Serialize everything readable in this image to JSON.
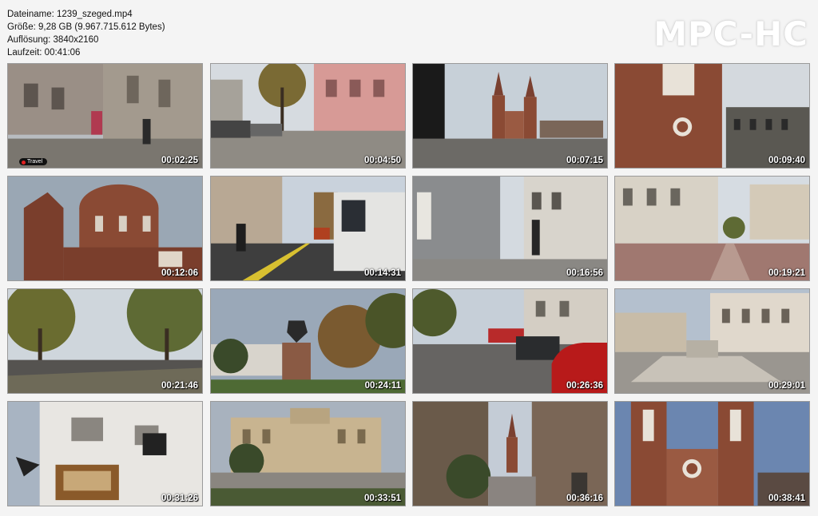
{
  "file_info": {
    "filename": "Dateiname: 1239_szeged.mp4",
    "size": "Größe: 9,28 GB (9.967.715.612 Bytes)",
    "resolution": "Auflösung: 3840x2160",
    "duration": "Laufzeit: 00:41:06"
  },
  "brand": "MPC-HC",
  "thumbnails": [
    {
      "timestamp": "00:02:25",
      "badge": "Travel"
    },
    {
      "timestamp": "00:04:50"
    },
    {
      "timestamp": "00:07:15"
    },
    {
      "timestamp": "00:09:40"
    },
    {
      "timestamp": "00:12:06"
    },
    {
      "timestamp": "00:14:31"
    },
    {
      "timestamp": "00:16:56"
    },
    {
      "timestamp": "00:19:21"
    },
    {
      "timestamp": "00:21:46"
    },
    {
      "timestamp": "00:24:11"
    },
    {
      "timestamp": "00:26:36"
    },
    {
      "timestamp": "00:29:01"
    },
    {
      "timestamp": "00:31:26"
    },
    {
      "timestamp": "00:33:51"
    },
    {
      "timestamp": "00:36:16"
    },
    {
      "timestamp": "00:38:41"
    }
  ],
  "colors": {
    "background": "#f4f4f4",
    "brick": "#8a4a34",
    "sky": "#c9d2dc",
    "foliage": "#5e6a34",
    "car_red": "#b81a1a"
  }
}
